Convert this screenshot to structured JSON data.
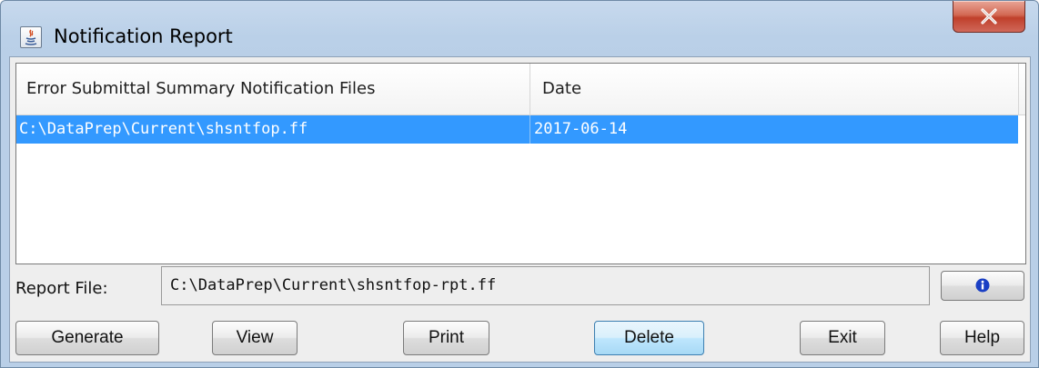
{
  "window": {
    "title": "Notification Report",
    "close_glyph": "✕"
  },
  "table": {
    "columns": [
      "Error Submittal Summary Notification Files",
      "Date"
    ],
    "rows": [
      {
        "file": "C:\\DataPrep\\Current\\shsntfop.ff",
        "date": "2017-06-14",
        "selected": true
      }
    ]
  },
  "report": {
    "label": "Report File:",
    "value": "C:\\DataPrep\\Current\\shsntfop-rpt.ff",
    "info_icon": "info-icon"
  },
  "buttons": {
    "generate": "Generate",
    "view": "View",
    "print": "Print",
    "delete": "Delete",
    "exit": "Exit",
    "help": "Help"
  },
  "colors": {
    "selection": "#3399ff",
    "titlebar": "#bad0e8",
    "close": "#c7402b",
    "info": "#1a3fc4"
  }
}
